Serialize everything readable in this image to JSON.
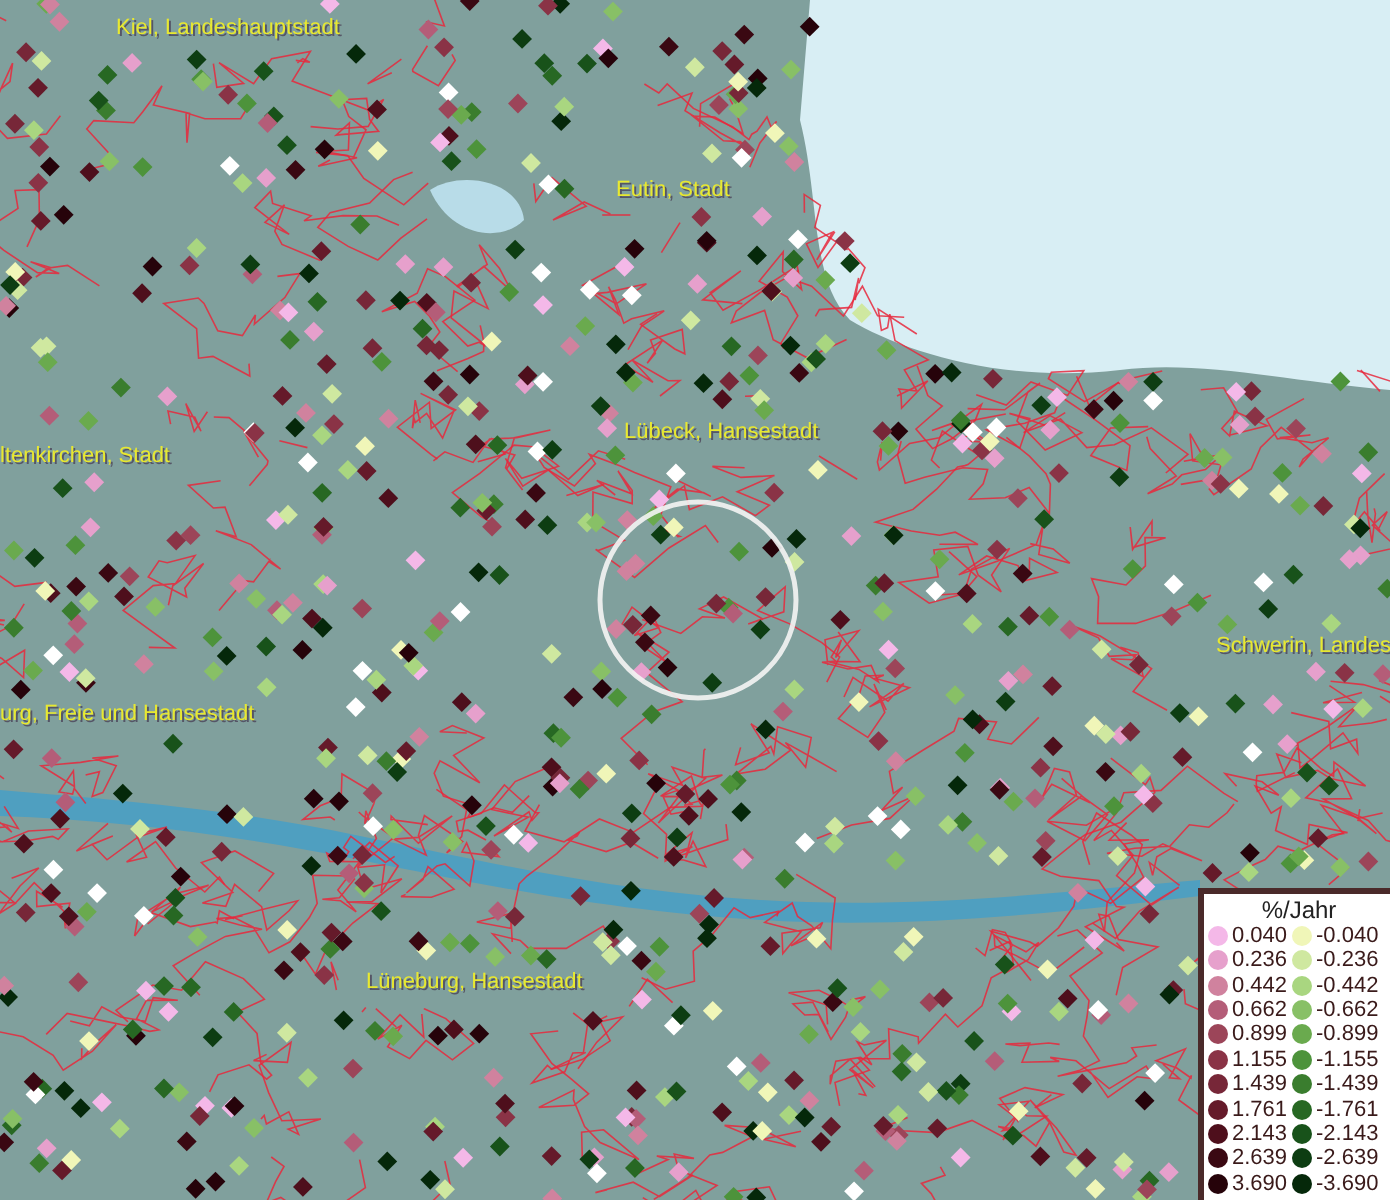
{
  "map": {
    "places": [
      {
        "name": "Kiel, Landeshauptstadt"
      },
      {
        "name": "Eutin, Stadt"
      },
      {
        "name": "Lübeck, Hansestadt"
      },
      {
        "name": "ltenkirchen, Stadt"
      },
      {
        "name": "urg, Freie und Hansestadt"
      },
      {
        "name": "Schwerin, Landes"
      },
      {
        "name": "Lüneburg, Hansestadt"
      }
    ]
  },
  "legend": {
    "title": "%/Jahr",
    "entries": [
      {
        "label": "0.040",
        "color": "#f4b8e8"
      },
      {
        "label": "-0.040",
        "color": "#f0f6b8"
      },
      {
        "label": "0.236",
        "color": "#e6a0cc"
      },
      {
        "label": "-0.236",
        "color": "#cfe8a0"
      },
      {
        "label": "0.442",
        "color": "#d0829e"
      },
      {
        "label": "-0.442",
        "color": "#a9d680"
      },
      {
        "label": "0.662",
        "color": "#b45d78"
      },
      {
        "label": "-0.662",
        "color": "#88c066"
      },
      {
        "label": "0.899",
        "color": "#9c4559"
      },
      {
        "label": "-0.899",
        "color": "#6aaa4e"
      },
      {
        "label": "1.155",
        "color": "#8a3346"
      },
      {
        "label": "-1.155",
        "color": "#4d933b"
      },
      {
        "label": "1.439",
        "color": "#772738"
      },
      {
        "label": "-1.439",
        "color": "#3a7d2e"
      },
      {
        "label": "1.761",
        "color": "#651a2a"
      },
      {
        "label": "-1.761",
        "color": "#276823"
      },
      {
        "label": "2.143",
        "color": "#4e0f1c"
      },
      {
        "label": "-2.143",
        "color": "#18521a"
      },
      {
        "label": "2.639",
        "color": "#3a0812"
      },
      {
        "label": "-2.639",
        "color": "#0d3d12"
      },
      {
        "label": "3.690",
        "color": "#26030a"
      },
      {
        "label": "-3.690",
        "color": "#05280a"
      }
    ]
  }
}
